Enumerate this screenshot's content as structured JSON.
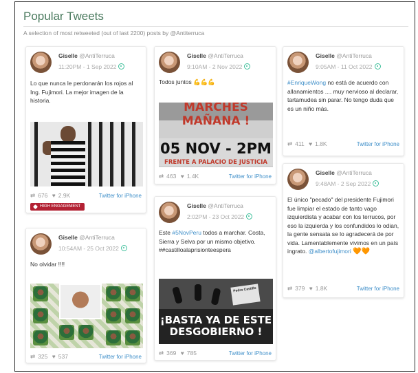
{
  "header": {
    "title": "Popular Tweets",
    "subtitle": "A selection of most retweeted (out of last 2200) posts by @Antiterruca"
  },
  "tweets": [
    {
      "user": "Giselle",
      "handle": "@AntiTerruca",
      "date": "11:20PM - 1 Sep 2022",
      "body": "Lo que nunca le perdonarán los rojos al Ing. Fujimori. La mejor imagen de la historia.",
      "retweets": "676",
      "likes": "2.9K",
      "source": "Twitter for iPhone",
      "badge": "HIGH ENGAGEMENT",
      "image": "man-behind-bars"
    },
    {
      "user": "Giselle",
      "handle": "@AntiTerruca",
      "date": "10:54AM - 25 Oct 2022",
      "body": "No olvidar !!!!",
      "retweets": "325",
      "likes": "537",
      "source": "Twitter for iPhone",
      "image": "politician-collage"
    },
    {
      "user": "Giselle",
      "handle": "@AntiTerruca",
      "date": "9:10AM - 2 Nov 2022",
      "body": "Todos juntos 💪💪💪",
      "retweets": "463",
      "likes": "1.4K",
      "source": "Twitter for iPhone",
      "image": "protest-poster",
      "image_text": {
        "line1": "MARCHES",
        "line2": "MAÑANA !",
        "line3": "05 NOV - 2PM",
        "line4": "FRENTE A PALACIO DE JUSTICIA"
      }
    },
    {
      "user": "Giselle",
      "handle": "@AntiTerruca",
      "date": "2:02PM - 23 Oct 2022",
      "body_prefix": "Este",
      "body_tag": "#5NovPeru",
      "body_suffix": "todos a marchar. Costa, Sierra y Selva por un mismo objetivo. ##castilloalaprisionteespera",
      "retweets": "369",
      "likes": "785",
      "source": "Twitter for iPhone",
      "image": "dark-protest",
      "image_text": {
        "sign": "Pedro Castillo",
        "line1": "¡BASTA YA DE ESTE",
        "line2": "DESGOBIERNO !"
      }
    },
    {
      "user": "Giselle",
      "handle": "@AntiTerruca",
      "date": "9:05AM - 11 Oct 2022",
      "body_tag": "#EnriqueWong",
      "body_suffix": "no está de acuerdo con allanamientos .... muy nervioso al declarar, tartamudea sin parar. No tengo duda que es un niño más.",
      "retweets": "411",
      "likes": "1.8K",
      "source": "Twitter for iPhone"
    },
    {
      "user": "Giselle",
      "handle": "@AntiTerruca",
      "date": "9:48AM - 2 Sep 2022",
      "body": "El único \"pecado\" del presidente Fujimori fue limpiar el estado de tanto vago izquierdista y acabar con los terrucos, por eso la izquierda y los confundidos lo odian, la gente sensata se lo agradecerá de por vida. Lamentablemente vivimos en un país ingrato.",
      "body_mention": "@albertofujimori",
      "body_emoji": "🧡🧡",
      "retweets": "379",
      "likes": "1.8K",
      "source": "Twitter for iPhone"
    }
  ],
  "icons": {
    "retweet": "retweet-icon",
    "like": "heart-icon",
    "twitter": "twitter-bird-icon",
    "badge": "engagement-badge-icon"
  },
  "colors": {
    "title": "#4a7a5e",
    "link": "#3f8fc9",
    "badge": "#b32234",
    "verified": "#3dbf9a"
  }
}
